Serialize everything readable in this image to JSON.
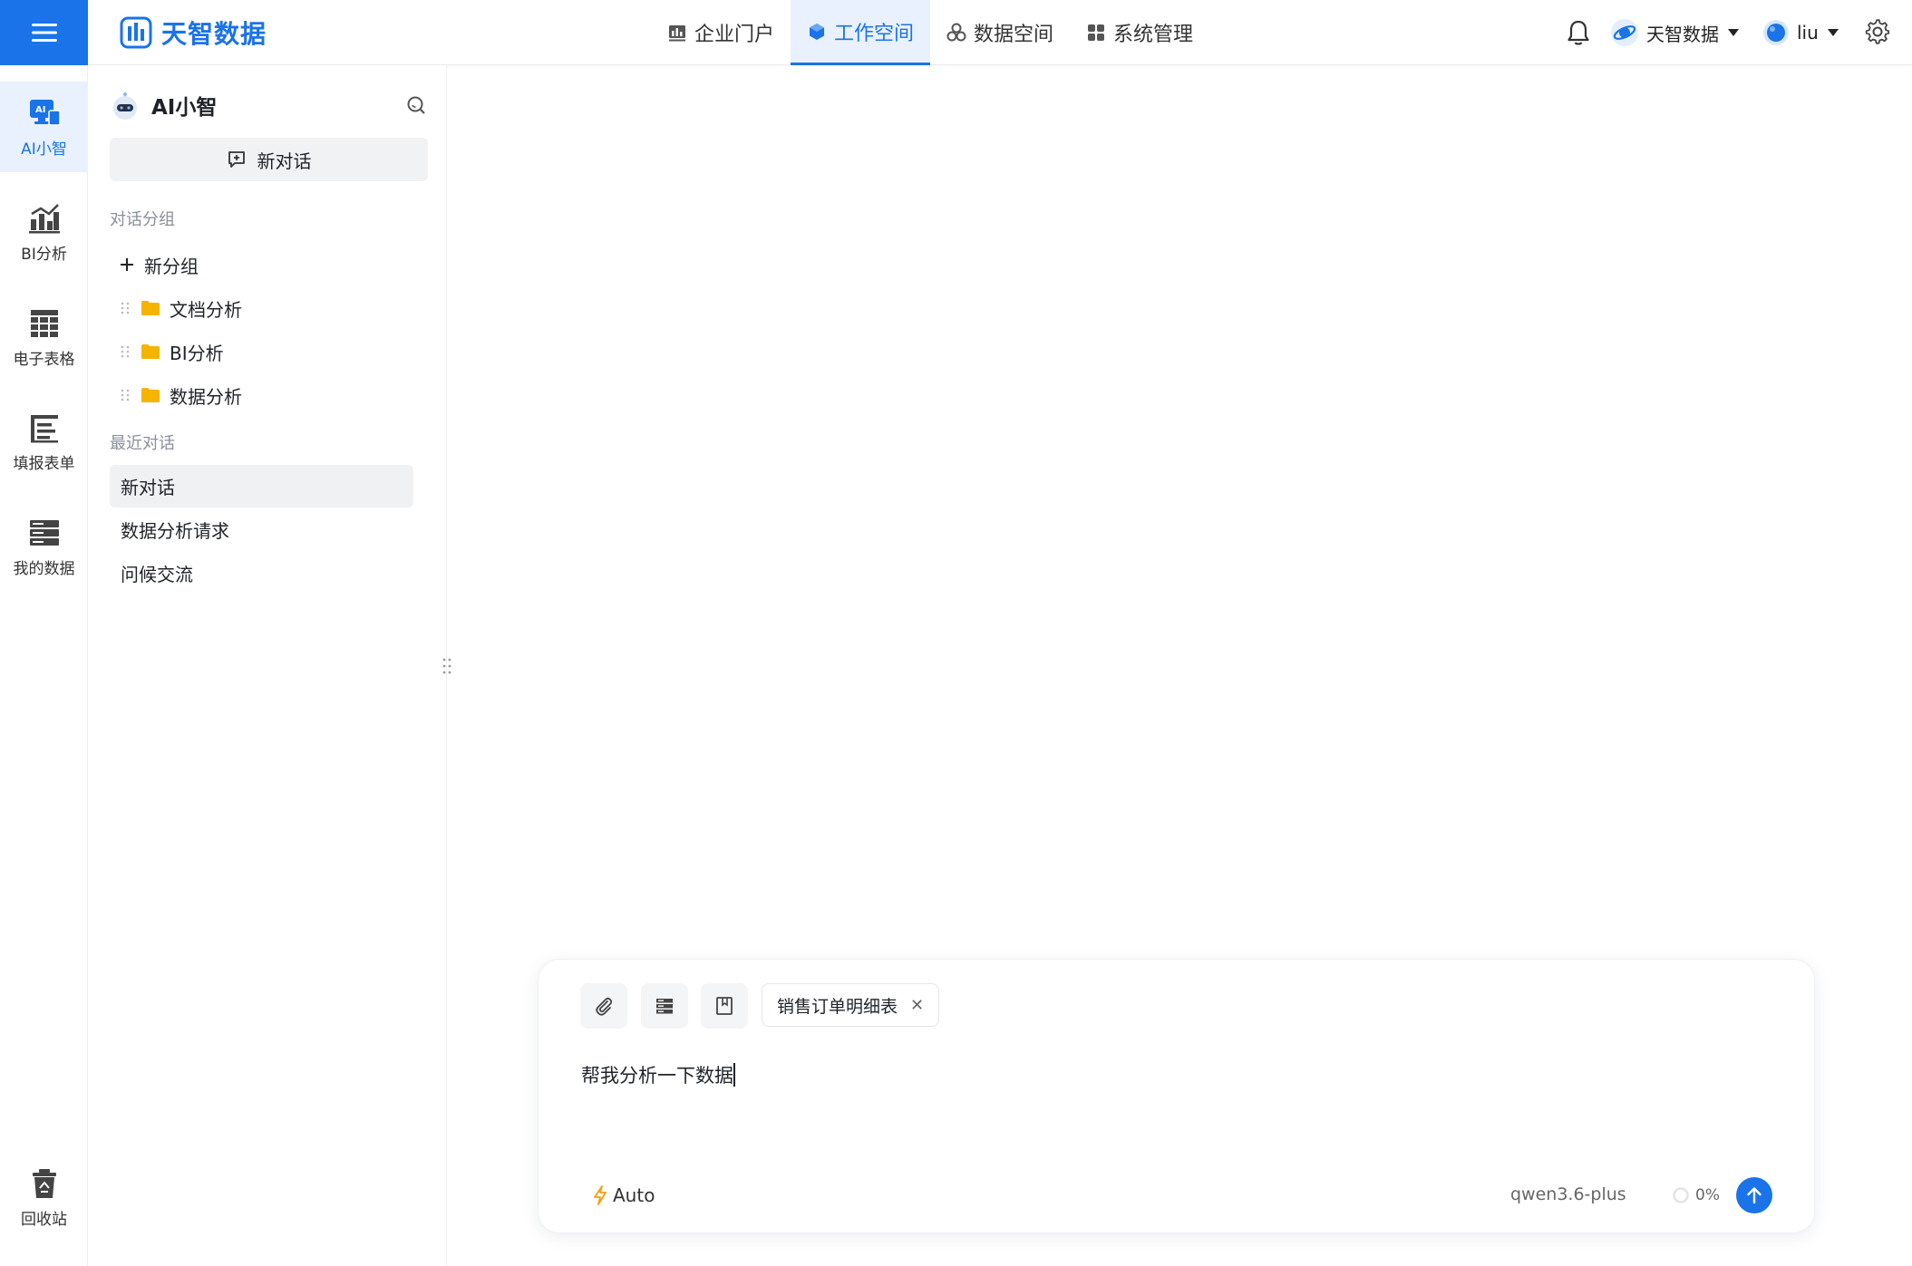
{
  "brand": {
    "name": "天智数据"
  },
  "nav": [
    {
      "label": "企业门户",
      "icon": "chart-bar-icon"
    },
    {
      "label": "工作空间",
      "icon": "cube-icon",
      "active": true
    },
    {
      "label": "数据空间",
      "icon": "data-cluster-icon"
    },
    {
      "label": "系统管理",
      "icon": "grid-apps-icon"
    }
  ],
  "header": {
    "org_name": "天智数据",
    "user_name": "liu"
  },
  "rail": [
    {
      "label": "AI小智",
      "icon": "ai-computer-icon",
      "active": true
    },
    {
      "label": "BI分析",
      "icon": "bi-chart-icon"
    },
    {
      "label": "电子表格",
      "icon": "spreadsheet-icon"
    },
    {
      "label": "填报表单",
      "icon": "form-icon"
    },
    {
      "label": "我的数据",
      "icon": "database-icon"
    },
    {
      "label": "回收站",
      "icon": "recycle-bin-icon"
    }
  ],
  "panel": {
    "title": "AI小智",
    "new_chat": "新对话",
    "groups_label": "对话分组",
    "new_group": "新分组",
    "groups": [
      "文档分析",
      "BI分析",
      "数据分析"
    ],
    "recent_label": "最近对话",
    "recent": [
      "新对话",
      "数据分析请求",
      "问候交流"
    ]
  },
  "composer": {
    "chip_label": "销售订单明细表",
    "prompt_text": "帮我分析一下数据",
    "mode_label": "Auto",
    "model_name": "qwen3.6-plus",
    "usage_label": "0%"
  },
  "colors": {
    "accent": "#1a73e8",
    "folder": "#f5b400",
    "active_bg": "#e8f1fd"
  }
}
